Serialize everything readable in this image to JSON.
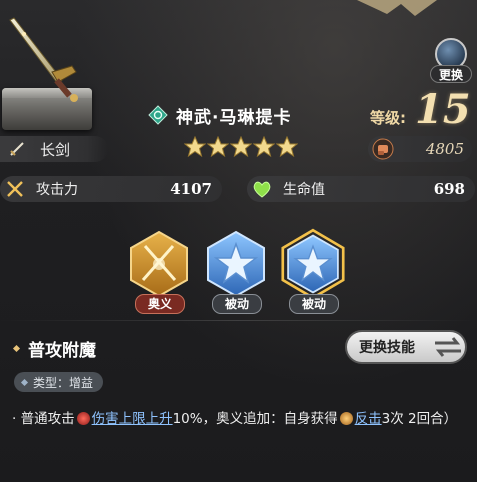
{
  "header": {
    "swap_label": "更换"
  },
  "character": {
    "name": "神武·马琳提卡",
    "star_count": 5,
    "level_label": "等级:",
    "level_value": "15"
  },
  "weapon": {
    "type_label": "长剑",
    "power_value": "4805"
  },
  "stats": {
    "attack_label": "攻击力",
    "attack_value": "4107",
    "hp_label": "生命值",
    "hp_value": "698"
  },
  "skills": [
    {
      "tag": "奥义",
      "selected": false
    },
    {
      "tag": "被动",
      "selected": false
    },
    {
      "tag": "被动",
      "selected": true
    }
  ],
  "detail": {
    "title": "普攻附魔",
    "change_button": "更换技能",
    "type_text": "类型：增益",
    "desc": {
      "prefix": "· 普通攻击",
      "kw1": "伤害上限上升",
      "mid": "10%，奥义追加：自身获得",
      "kw2": "反击",
      "suffix": "3次 2回合）"
    }
  },
  "colors": {
    "accent_gold": "#e8c37a",
    "keyword_blue": "#8fc3ff",
    "tag_red": "#7a2a22",
    "tag_gray": "#3a3d42"
  }
}
